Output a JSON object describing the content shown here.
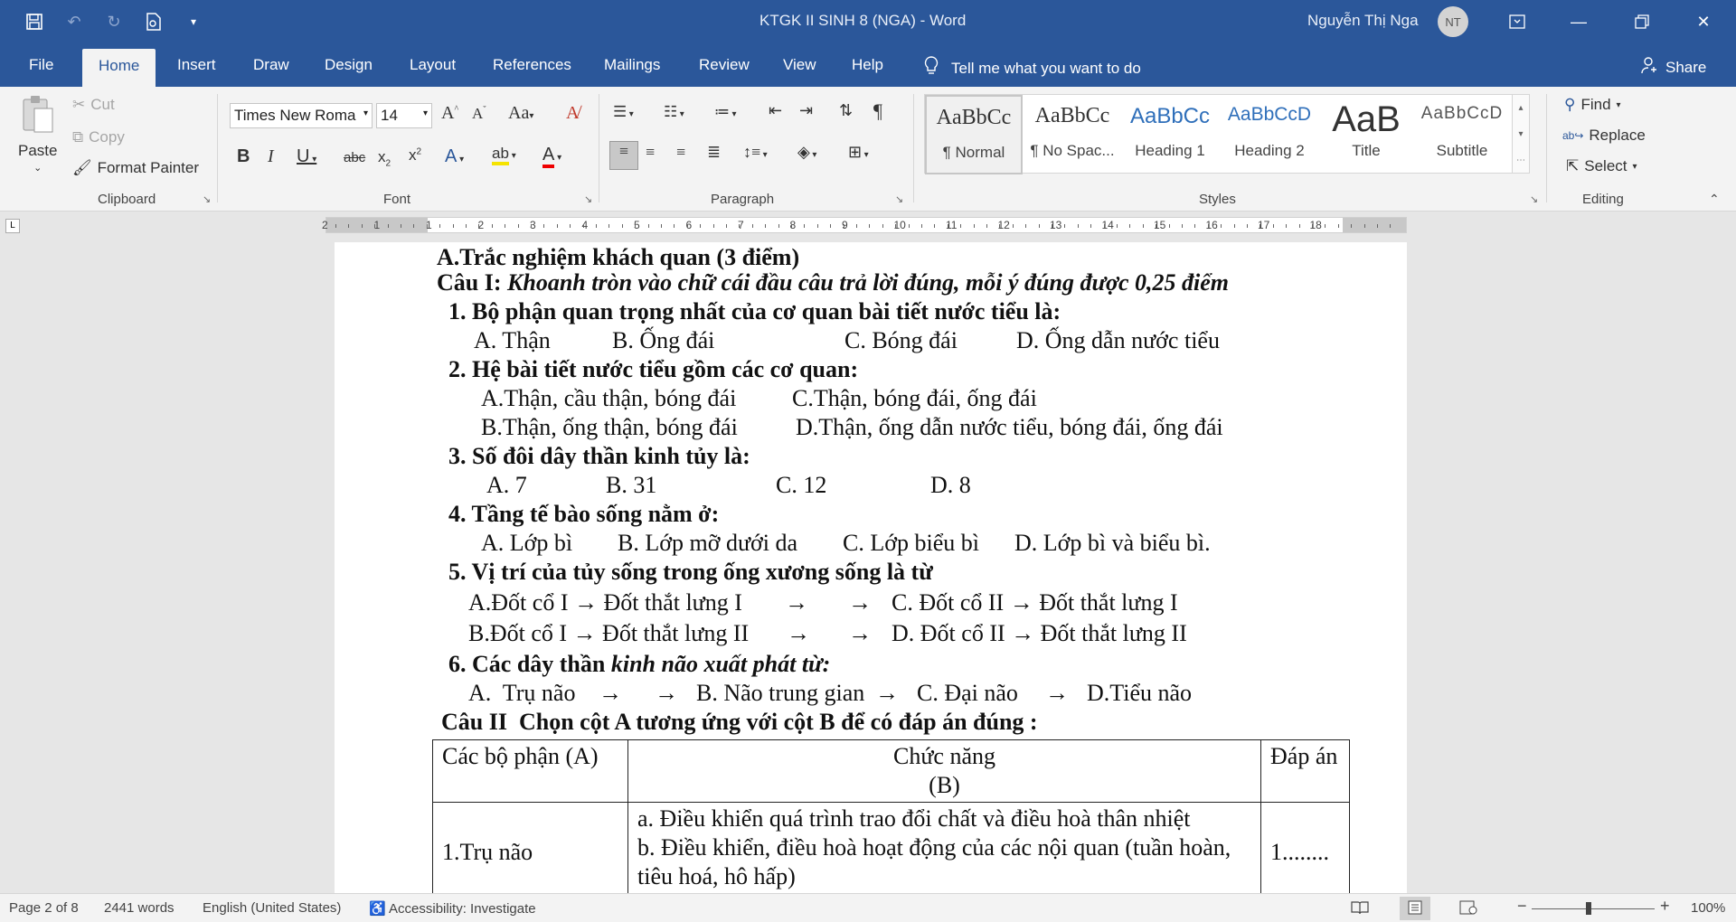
{
  "window": {
    "title": "KTGK II SINH 8 (NGA)  -  Word",
    "user": "Nguyễn Thị Nga",
    "avatar_initials": "NT"
  },
  "tabs": [
    {
      "label": "File"
    },
    {
      "label": "Home"
    },
    {
      "label": "Insert"
    },
    {
      "label": "Draw"
    },
    {
      "label": "Design"
    },
    {
      "label": "Layout"
    },
    {
      "label": "References"
    },
    {
      "label": "Mailings"
    },
    {
      "label": "Review"
    },
    {
      "label": "View"
    },
    {
      "label": "Help"
    }
  ],
  "tell_me": "Tell me what you want to do",
  "share_label": "Share",
  "clipboard": {
    "paste": "Paste",
    "cut": "Cut",
    "copy": "Copy",
    "format_painter": "Format Painter",
    "group_label": "Clipboard"
  },
  "font": {
    "name": "Times New Roma",
    "size": "14",
    "group_label": "Font"
  },
  "paragraph": {
    "group_label": "Paragraph"
  },
  "styles": {
    "group_label": "Styles",
    "items": [
      {
        "preview": "AaBbCc",
        "name": "¶ Normal"
      },
      {
        "preview": "AaBbCc",
        "name": "¶ No Spac..."
      },
      {
        "preview": "AaBbCc",
        "name": "Heading 1"
      },
      {
        "preview": "AaBbCcD",
        "name": "Heading 2"
      },
      {
        "preview": "AaB",
        "name": "Title"
      },
      {
        "preview": "AaBbCcD",
        "name": "Subtitle"
      }
    ]
  },
  "editing": {
    "find": "Find",
    "replace": "Replace",
    "select": "Select",
    "group_label": "Editing"
  },
  "ruler_numbers": [
    "2",
    "1",
    "1",
    "2",
    "3",
    "4",
    "5",
    "6",
    "7",
    "8",
    "9",
    "10",
    "11",
    "12",
    "13",
    "14",
    "15",
    "16",
    "17",
    "18"
  ],
  "document": {
    "heading": "A.Trắc nghiệm khách quan (3 điểm)",
    "cau1_label": "Câu I: ",
    "cau1_text": "Khoanh tròn vào chữ cái đầu câu trả lời đúng, mỗi ý đúng được 0,25 điểm",
    "q1": "1. Bộ phận quan trọng nhất của cơ quan bài tiết nước tiểu là:",
    "q1_a": "A. Thận",
    "q1_b": "B. Ống đái",
    "q1_c": "C. Bóng đái",
    "q1_d": "D. Ống dẫn nước tiểu",
    "q2": "2. Hệ bài tiết nước tiểu gồm các cơ quan:",
    "q2_a": "A.Thận, cầu thận, bóng đái",
    "q2_c": "C.Thận, bóng đái, ống đái",
    "q2_b": "B.Thận, ống thận, bóng đái",
    "q2_d": "D.Thận, ống dẫn nước tiểu, bóng đái, ống đái",
    "q3": "3. Số đôi dây thần kinh tủy là:",
    "q3_a": "A. 7",
    "q3_b": "B. 31",
    "q3_c": "C. 12",
    "q3_d": "D. 8",
    "q4": "4. Tầng tế bào sống nằm ở:",
    "q4_a": "A. Lớp bì",
    "q4_b": "B. Lớp mỡ dưới da",
    "q4_c": "C. Lớp biểu bì",
    "q4_d": "D. Lớp bì và biểu bì.",
    "q5": "5. Vị trí của tủy sống trong ống xương sống là từ",
    "q5_a": "A.Đốt cổ I → Đốt thắt lưng I",
    "q5_c": "C. Đốt cổ II → Đốt thắt lưng I",
    "q5_b": "B.Đốt cổ I → Đốt thắt lưng II",
    "q5_d": "D. Đốt cổ II → Đốt thắt lưng II",
    "arrow": "→",
    "q6_bold": "6. Các dây thần ",
    "q6_italic": "kinh não xuất phát từ:",
    "q6_a": "A.  Trụ não",
    "q6_b": "B. Não trung gian",
    "q6_c": "C. Đại não",
    "q6_d": "D.Tiểu não",
    "cau2": "Câu II  Chọn cột A tương ứng với cột B để có đáp án đúng :",
    "table": {
      "col_a": "Các bộ phận (A)",
      "col_b_1": "Chức năng",
      "col_b_2": "(B)",
      "col_c": "Đáp án",
      "row1_a": "1.Trụ não",
      "row1_b1": "a. Điều khiển quá trình trao đổi chất và điều hoà thân nhiệt",
      "row1_b2": "b. Điều khiển, điều hoà hoạt động của các nội quan (tuần hoàn, tiêu hoá, hô hấp)",
      "row1_c": "1........"
    }
  },
  "status": {
    "page": "Page 2 of 8",
    "words": "2441 words",
    "language": "English (United States)",
    "accessibility": "Accessibility: Investigate",
    "zoom": "100%"
  }
}
